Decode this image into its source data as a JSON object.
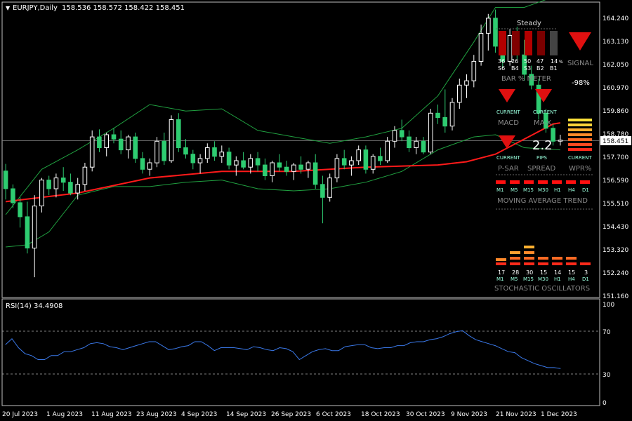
{
  "header": {
    "symbol_label": "EURJPY,Daily",
    "ohlc": "158.536 158.572 158.422 158.451",
    "current_price": "158.451"
  },
  "rsi": {
    "label": "RSI(14) 34.4908",
    "levels": [
      "100",
      "70",
      "30",
      "0"
    ]
  },
  "colors": {
    "bull": "#ffffff",
    "bear": "#2ecc71",
    "ma": "#ff1a1a",
    "bands": "#20a040",
    "rsi": "#3a78e8"
  },
  "x_labels": [
    "20 Jul 2023",
    "1 Aug 2023",
    "11 Aug 2023",
    "23 Aug 2023",
    "4 Sep 2023",
    "14 Sep 2023",
    "26 Sep 2023",
    "6 Oct 2023",
    "18 Oct 2023",
    "30 Oct 2023",
    "9 Nov 2023",
    "21 Nov 2023",
    "1 Dec 2023"
  ],
  "y_labels": [
    "164.240",
    "163.130",
    "162.050",
    "160.970",
    "159.860",
    "158.780",
    "157.700",
    "156.590",
    "155.510",
    "154.430",
    "153.320",
    "152.240",
    "151.160"
  ],
  "dashboard": {
    "steady": "Steady",
    "bar_pct": "14",
    "bar_pct_sym": "%",
    "bar_cols": [
      "36",
      "26",
      "50",
      "47",
      "14"
    ],
    "bar_codes": [
      "S6",
      "B4",
      "S3",
      "B2",
      "B1"
    ],
    "bar_meter_label": "BAR % METER",
    "signal_label": "SIGNAL",
    "signal_value": "-98%",
    "current": "CURRENT",
    "macd_label": "MACD",
    "ma_label": "MA-X",
    "psar_label": "P-SAR",
    "spread_value": "2.2",
    "pips": "PIPS",
    "spread_label": "SPREAD",
    "wpr_label": "WPR%",
    "tf": [
      "M1",
      "M5",
      "M15",
      "M30",
      "H1",
      "H4",
      "D1"
    ],
    "ma_trend_label": "MOVING AVERAGE TREND",
    "stoch_values": [
      "17",
      "28",
      "30",
      "15",
      "14",
      "15",
      "3"
    ],
    "stoch_label": "STOCHASTIC OSCILLATORS"
  },
  "chart_data": {
    "type": "candlestick",
    "y_range": [
      151.16,
      164.78
    ],
    "current_price": 158.451,
    "candles": [
      [
        157.02,
        157.35,
        155.7,
        156.2
      ],
      [
        156.2,
        156.4,
        155.3,
        155.55
      ],
      [
        155.55,
        155.8,
        154.4,
        154.9
      ],
      [
        154.9,
        155.6,
        153.2,
        153.45
      ],
      [
        153.45,
        155.9,
        152.1,
        155.4
      ],
      [
        155.4,
        156.7,
        155.1,
        156.6
      ],
      [
        156.6,
        156.8,
        155.9,
        156.2
      ],
      [
        156.2,
        156.9,
        155.8,
        156.7
      ],
      [
        156.7,
        157.2,
        156.1,
        156.5
      ],
      [
        156.5,
        156.9,
        155.9,
        156.0
      ],
      [
        156.0,
        156.7,
        155.7,
        156.4
      ],
      [
        156.4,
        157.4,
        156.1,
        157.2
      ],
      [
        157.2,
        158.9,
        157.0,
        158.6
      ],
      [
        158.6,
        158.95,
        157.9,
        158.1
      ],
      [
        158.1,
        158.8,
        157.7,
        158.7
      ],
      [
        158.7,
        159.0,
        158.3,
        158.5
      ],
      [
        158.5,
        158.9,
        157.8,
        158.0
      ],
      [
        158.0,
        158.7,
        157.6,
        158.6
      ],
      [
        158.6,
        158.8,
        157.4,
        157.6
      ],
      [
        157.6,
        157.9,
        156.9,
        157.1
      ],
      [
        157.1,
        157.6,
        156.8,
        157.4
      ],
      [
        157.4,
        158.6,
        157.2,
        158.4
      ],
      [
        158.4,
        158.8,
        157.3,
        157.5
      ],
      [
        157.5,
        159.6,
        157.4,
        159.4
      ],
      [
        159.4,
        159.7,
        157.9,
        158.1
      ],
      [
        158.1,
        158.5,
        157.6,
        157.8
      ],
      [
        157.8,
        158.0,
        157.1,
        157.4
      ],
      [
        157.4,
        157.8,
        156.9,
        157.6
      ],
      [
        157.6,
        158.3,
        157.4,
        158.1
      ],
      [
        158.1,
        158.4,
        157.5,
        157.7
      ],
      [
        157.7,
        158.2,
        157.4,
        157.9
      ],
      [
        157.9,
        158.1,
        157.1,
        157.3
      ],
      [
        157.3,
        157.7,
        156.8,
        157.5
      ],
      [
        157.5,
        157.9,
        157.1,
        157.2
      ],
      [
        157.2,
        157.8,
        156.9,
        157.6
      ],
      [
        157.6,
        157.9,
        157.0,
        157.3
      ],
      [
        157.3,
        157.6,
        156.6,
        156.8
      ],
      [
        156.8,
        157.5,
        156.5,
        157.4
      ],
      [
        157.4,
        157.8,
        157.0,
        157.2
      ],
      [
        157.2,
        157.5,
        156.8,
        157.0
      ],
      [
        157.0,
        157.4,
        156.6,
        157.3
      ],
      [
        157.3,
        157.7,
        156.9,
        157.1
      ],
      [
        157.1,
        157.5,
        156.7,
        157.4
      ],
      [
        157.4,
        157.8,
        156.2,
        156.4
      ],
      [
        156.4,
        156.8,
        154.6,
        155.8
      ],
      [
        155.8,
        156.9,
        155.6,
        156.7
      ],
      [
        156.7,
        157.8,
        156.5,
        157.6
      ],
      [
        157.6,
        158.0,
        157.1,
        157.3
      ],
      [
        157.3,
        157.7,
        156.8,
        157.5
      ],
      [
        157.5,
        158.2,
        157.3,
        158.0
      ],
      [
        158.0,
        158.2,
        156.9,
        157.1
      ],
      [
        157.1,
        157.8,
        156.9,
        157.7
      ],
      [
        157.7,
        158.1,
        157.3,
        157.5
      ],
      [
        157.5,
        158.6,
        157.4,
        158.4
      ],
      [
        158.4,
        159.1,
        158.1,
        158.9
      ],
      [
        158.9,
        159.4,
        158.4,
        158.6
      ],
      [
        158.6,
        158.9,
        157.9,
        158.1
      ],
      [
        158.1,
        158.6,
        157.8,
        158.4
      ],
      [
        158.4,
        158.6,
        157.8,
        157.9
      ],
      [
        157.9,
        159.9,
        157.8,
        159.7
      ],
      [
        159.7,
        160.1,
        159.2,
        159.5
      ],
      [
        159.5,
        160.8,
        158.8,
        159.1
      ],
      [
        159.1,
        160.4,
        158.9,
        160.2
      ],
      [
        160.2,
        161.3,
        159.9,
        161.0
      ],
      [
        161.0,
        161.5,
        160.4,
        161.2
      ],
      [
        161.2,
        162.4,
        160.9,
        162.1
      ],
      [
        162.1,
        163.8,
        161.9,
        163.4
      ],
      [
        163.4,
        164.3,
        162.6,
        164.1
      ],
      [
        164.1,
        164.5,
        162.5,
        162.8
      ],
      [
        162.8,
        163.2,
        161.8,
        162.1
      ],
      [
        162.1,
        163.6,
        161.9,
        163.3
      ],
      [
        163.3,
        163.7,
        162.2,
        162.4
      ],
      [
        162.4,
        163.1,
        161.2,
        161.5
      ],
      [
        161.5,
        161.9,
        160.8,
        161.0
      ],
      [
        161.0,
        161.3,
        159.4,
        159.7
      ],
      [
        159.7,
        159.9,
        158.8,
        159.0
      ],
      [
        159.0,
        159.2,
        158.2,
        158.4
      ],
      [
        158.4,
        158.7,
        158.2,
        158.45
      ]
    ],
    "moving_average": [
      [
        0,
        155.6
      ],
      [
        10,
        156.0
      ],
      [
        20,
        156.7
      ],
      [
        30,
        157.0
      ],
      [
        40,
        157.0
      ],
      [
        50,
        157.2
      ],
      [
        60,
        157.3
      ],
      [
        64,
        157.45
      ],
      [
        68,
        157.8
      ],
      [
        72,
        158.5
      ],
      [
        76,
        159.2
      ],
      [
        77,
        159.25
      ]
    ],
    "bollinger_upper": [
      [
        0,
        155.0
      ],
      [
        5,
        157.1
      ],
      [
        10,
        158.0
      ],
      [
        15,
        159.0
      ],
      [
        20,
        160.1
      ],
      [
        25,
        159.8
      ],
      [
        30,
        159.9
      ],
      [
        35,
        158.9
      ],
      [
        40,
        158.6
      ],
      [
        45,
        158.3
      ],
      [
        50,
        158.6
      ],
      [
        55,
        159.0
      ],
      [
        60,
        160.5
      ],
      [
        65,
        163.0
      ],
      [
        68,
        164.6
      ],
      [
        72,
        164.6
      ],
      [
        77,
        165.2
      ]
    ],
    "bollinger_lower": [
      [
        0,
        153.5
      ],
      [
        3,
        153.6
      ],
      [
        6,
        154.2
      ],
      [
        10,
        155.9
      ],
      [
        15,
        156.3
      ],
      [
        20,
        156.3
      ],
      [
        25,
        156.5
      ],
      [
        30,
        156.6
      ],
      [
        35,
        156.2
      ],
      [
        40,
        156.1
      ],
      [
        45,
        156.2
      ],
      [
        50,
        156.5
      ],
      [
        55,
        157.0
      ],
      [
        60,
        158.0
      ],
      [
        65,
        158.6
      ],
      [
        68,
        158.7
      ],
      [
        72,
        158.1
      ],
      [
        77,
        158.0
      ]
    ],
    "rsi": [
      59,
      65,
      56,
      50,
      48,
      44,
      44,
      48,
      48,
      52,
      52,
      54,
      56,
      60,
      61,
      60,
      57,
      56,
      54,
      56,
      58,
      60,
      62,
      62,
      58,
      54,
      55,
      57,
      58,
      62,
      62,
      58,
      53,
      56,
      56,
      56,
      55,
      54,
      57,
      56,
      54,
      53,
      56,
      55,
      52,
      44,
      48,
      52,
      54,
      55,
      53,
      53,
      57,
      58,
      59,
      59,
      56,
      55,
      56,
      56,
      58,
      58,
      61,
      62,
      62,
      64,
      65,
      67,
      70,
      72,
      73,
      68,
      64,
      62,
      60,
      58,
      55,
      52,
      51,
      46,
      43,
      40,
      38,
      36,
      36,
      35
    ]
  }
}
